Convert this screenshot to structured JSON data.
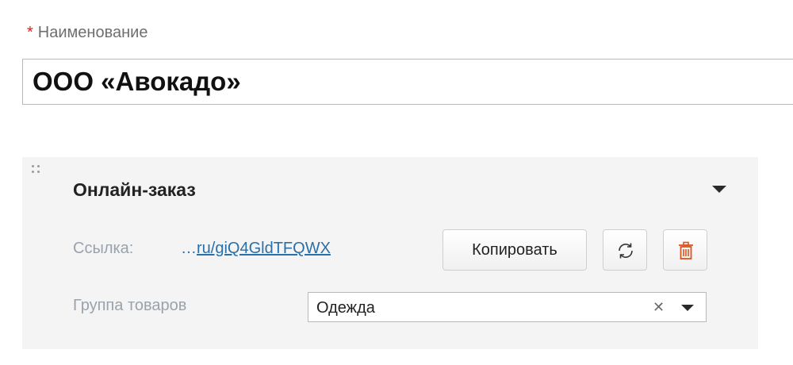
{
  "name_field": {
    "required_mark": "*",
    "label": "Наименование",
    "value": "ООО «Авокадо»"
  },
  "online_order": {
    "title": "Онлайн-заказ",
    "link_label": "Ссылка:",
    "link_ellipsis": "…",
    "link_text": "ru/giQ4GldTFQWX",
    "copy_button_label": "Копировать",
    "group_label": "Группа товаров",
    "group_value": "Одежда"
  },
  "icons": {
    "drag": "drag-handle-icon",
    "collapse": "chevron-down-icon",
    "refresh": "refresh-icon",
    "delete": "trash-icon",
    "clear": "clear-icon",
    "dropdown": "chevron-down-icon"
  },
  "colors": {
    "required": "#e02020",
    "link": "#2b6fa8",
    "delete_icon": "#d9541e",
    "panel_bg": "#f4f4f4"
  }
}
